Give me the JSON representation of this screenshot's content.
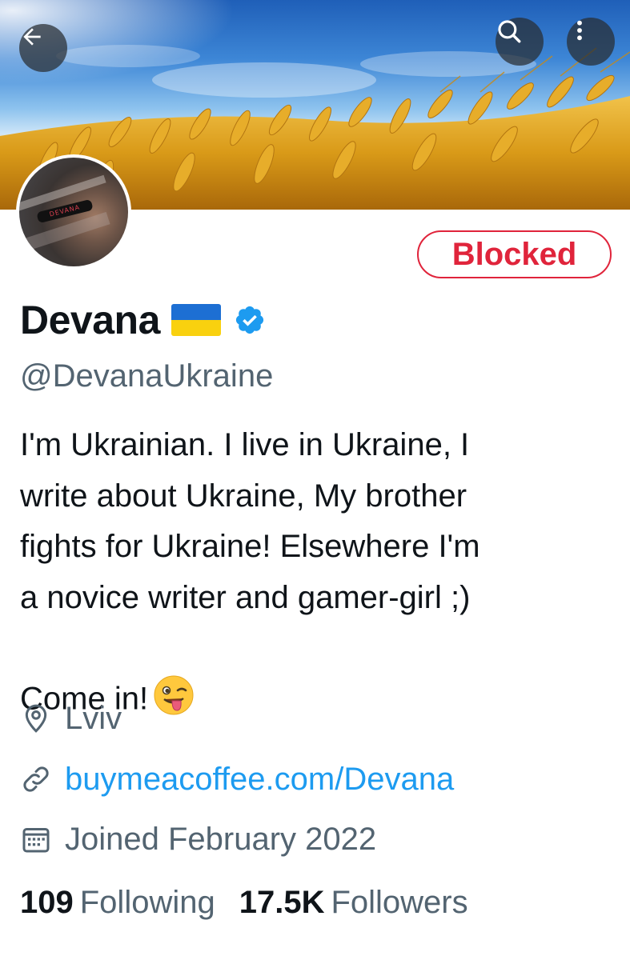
{
  "profile": {
    "display_name": "Devana",
    "handle": "@DevanaUkraine",
    "blocked_label": "Blocked",
    "bio": "I'm Ukrainian. I live in Ukraine, I\nwrite about Ukraine,  My brother\nfights for Ukraine! Elsewhere I'm\na novice writer and gamer-girl ;)\nCome in!",
    "bio_emoji": "😜",
    "avatar_text": "DEVANA",
    "location": "Lviv",
    "website": "buymeacoffee.com/Devana",
    "joined": "Joined February 2022",
    "following_count": "109",
    "following_label": "Following",
    "followers_count": "17.5K",
    "followers_label": "Followers"
  },
  "icons": {
    "back": "arrow-left-icon",
    "search": "search-icon",
    "more": "more-vertical-icon",
    "verified": "verified-badge-icon",
    "flag": "ukraine-flag-icon",
    "location": "location-pin-icon",
    "link": "link-icon",
    "calendar": "calendar-icon"
  },
  "colors": {
    "accent": "#1d9bf0",
    "blocked_red": "#e0243b",
    "secondary_text": "#536471",
    "primary_text": "#0f1419"
  }
}
